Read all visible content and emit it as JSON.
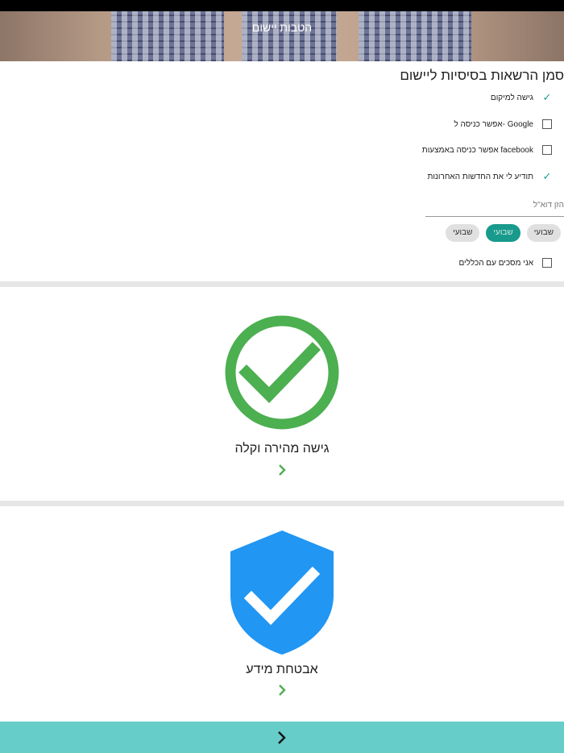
{
  "header": {
    "title": "הטבות יישום"
  },
  "permissions": {
    "title": "סמן הרשאות בסיסיות ליישום",
    "items": [
      {
        "label": "גישה למיקום",
        "checked": true
      },
      {
        "label": "Google -אפשר כניסה ל",
        "checked": false
      },
      {
        "label": "facebook אפשר כניסה באמצעות",
        "checked": false
      },
      {
        "label": "תודיע לי את החדשות האחרונות",
        "checked": true
      }
    ],
    "email_placeholder": "הזן דוא\"ל",
    "frequency_options": [
      {
        "label": "שבועי",
        "selected": false
      },
      {
        "label": "שבועי",
        "selected": true
      },
      {
        "label": "שבועי",
        "selected": false
      }
    ],
    "terms": {
      "label": "אני מסכים עם הכללים",
      "checked": false
    }
  },
  "benefits": [
    {
      "title": "גישה מהירה וקלה",
      "icon": "check-circle-icon",
      "color": "#4caf50"
    },
    {
      "title": "אבטחת מידע",
      "icon": "shield-check-icon",
      "color": "#2196f3"
    }
  ],
  "colors": {
    "accent": "#189a8c",
    "footer": "#66cdc9",
    "chevron": "#4caf50"
  }
}
